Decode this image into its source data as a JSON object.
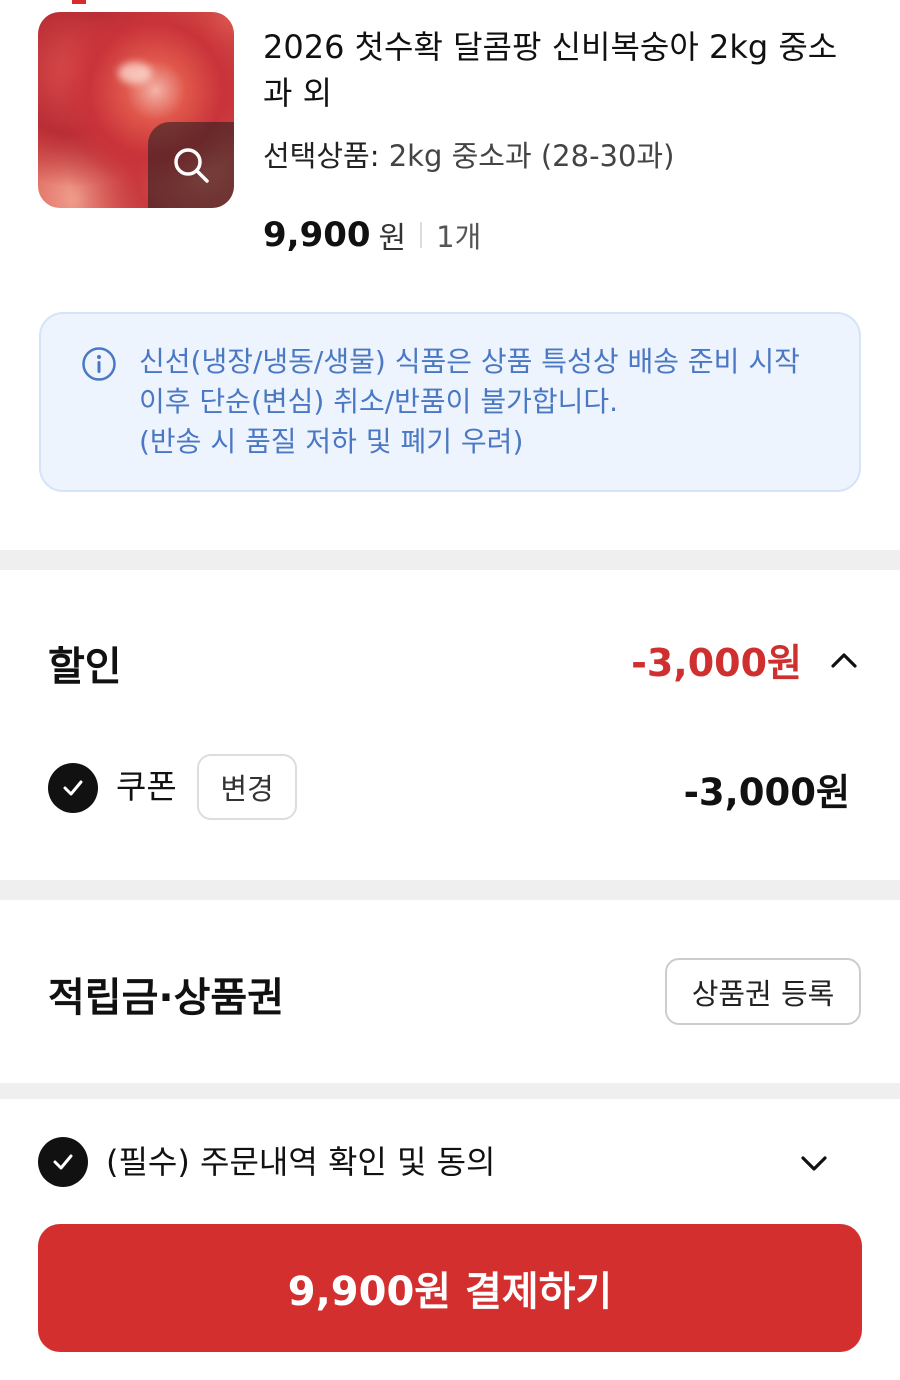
{
  "product": {
    "title": "2026 첫수확 달콤팡 신비복숭아 2kg 중소과 외",
    "option_label": "선택상품:",
    "option_value": "2kg 중소과 (28-30과)",
    "price": "9,900",
    "price_unit": "원",
    "quantity": "1개",
    "image_icon": "search-icon"
  },
  "notice": {
    "icon": "info-icon",
    "lines": [
      "신선(냉장/냉동/생물) 식품은 상품 특성상 배송 준비 시작",
      "이후 단순(변심) 취소/반품이 불가합니다.",
      "(반송 시 품질 저하 및 폐기 우려)"
    ]
  },
  "discount": {
    "title": "할인",
    "total": "-3,000원",
    "toggle_icon": "chevron-up-icon",
    "coupon_label": "쿠폰",
    "change_label": "변경",
    "coupon_amount": "-3,000원"
  },
  "points": {
    "title": "적립금·상품권",
    "register_label": "상품권 등록"
  },
  "agreement": {
    "label": "(필수) 주문내역 확인 및 동의",
    "toggle_icon": "chevron-down-icon"
  },
  "pay_button": {
    "label": "9,900원 결제하기"
  },
  "colors": {
    "accent": "#d32f2f",
    "discount_red": "#cf2f2f",
    "notice_bg": "#eef4fd",
    "notice_text": "#4a78c4"
  }
}
